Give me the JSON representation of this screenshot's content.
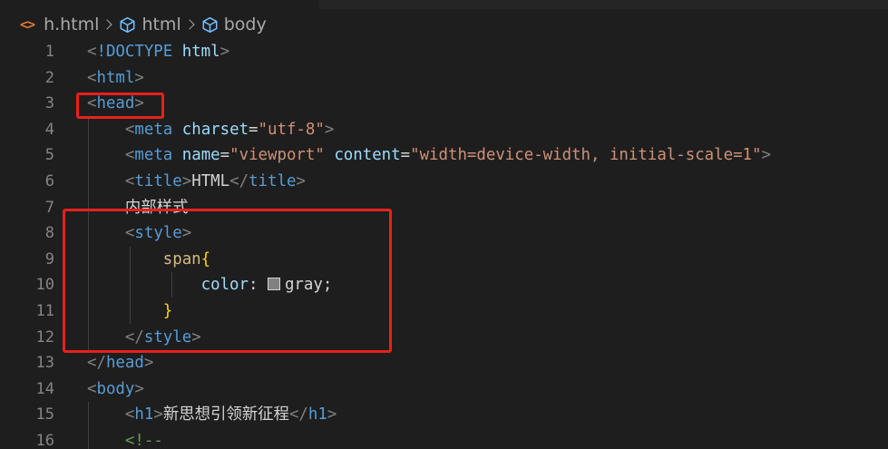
{
  "breadcrumb": {
    "file_icon": "<>",
    "file": "h.html",
    "item2": "html",
    "item3": "body"
  },
  "line_numbers": [
    "1",
    "2",
    "3",
    "4",
    "5",
    "6",
    "7",
    "8",
    "9",
    "10",
    "11",
    "12",
    "13",
    "14",
    "15",
    "16"
  ],
  "code": {
    "l1_doctype": "!DOCTYPE",
    "l1_html": "html",
    "tag_html": "html",
    "tag_head": "head",
    "tag_meta": "meta",
    "attr_charset": "charset",
    "val_charset": "\"utf-8\"",
    "attr_name": "name",
    "val_name": "\"viewport\"",
    "attr_content": "content",
    "val_content": "\"width=device-width, initial-scale=1\"",
    "tag_title": "title",
    "title_text": "HTML",
    "line7_text": "内部样式",
    "tag_style": "style",
    "selector": "span",
    "brace_open": "{",
    "property": "color",
    "value": "gray",
    "brace_close": "}",
    "tag_body": "body",
    "tag_h1": "h1",
    "h1_text": "新思想引领新征程",
    "comment_open": "<!--"
  },
  "colors": {
    "swatch": "#808080",
    "highlight": "#e8201c"
  }
}
